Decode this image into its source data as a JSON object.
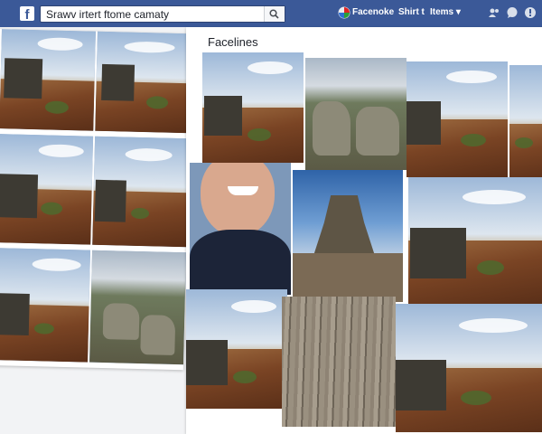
{
  "topbar": {
    "search_value": "Srawv irtert ftome camaty",
    "nav_items": [
      "Facenoke",
      "Shirt t",
      "Items ▾"
    ],
    "icons": [
      "facebook-logo",
      "search-icon",
      "profile-icon",
      "friends-icon",
      "messages-icon",
      "notifications-icon"
    ],
    "brand_color": "#3b5998"
  },
  "panel_right": {
    "title": "Facelines"
  }
}
